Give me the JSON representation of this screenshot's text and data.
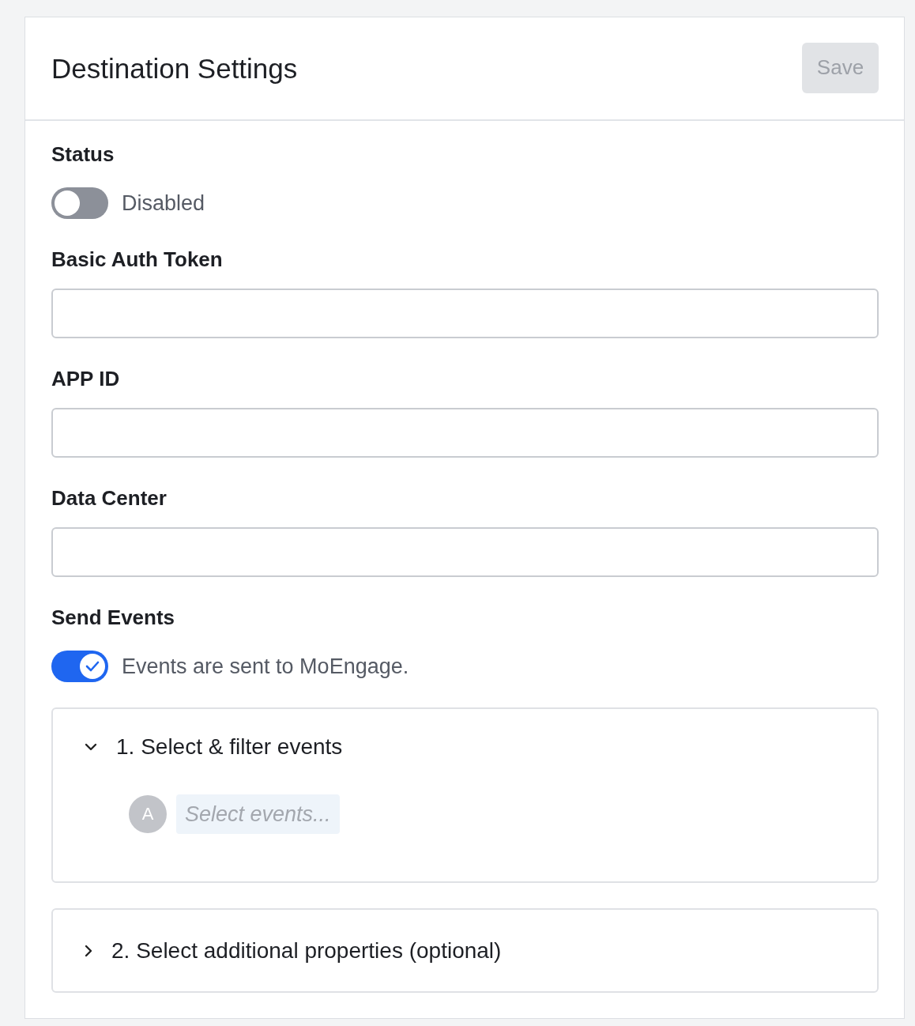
{
  "header": {
    "title": "Destination Settings",
    "save_button": {
      "label": "Save",
      "disabled": true
    }
  },
  "fields": [
    {
      "kind": "toggle",
      "label": "Status",
      "on": false,
      "text": "Disabled"
    },
    {
      "kind": "text_input",
      "label": "Basic Auth Token"
    },
    {
      "kind": "text_input",
      "label": "APP ID"
    },
    {
      "kind": "text_input",
      "label": "Data Center"
    },
    {
      "kind": "toggle",
      "label": "Send Events",
      "on": true,
      "text": "Events are sent to MoEngage."
    }
  ],
  "panels": [
    {
      "title": "1. Select & filter events",
      "expanded": true,
      "avatar": "A",
      "placeholder": "Select events..."
    },
    {
      "title": "2. Select additional properties (optional)",
      "expanded": false
    }
  ]
}
